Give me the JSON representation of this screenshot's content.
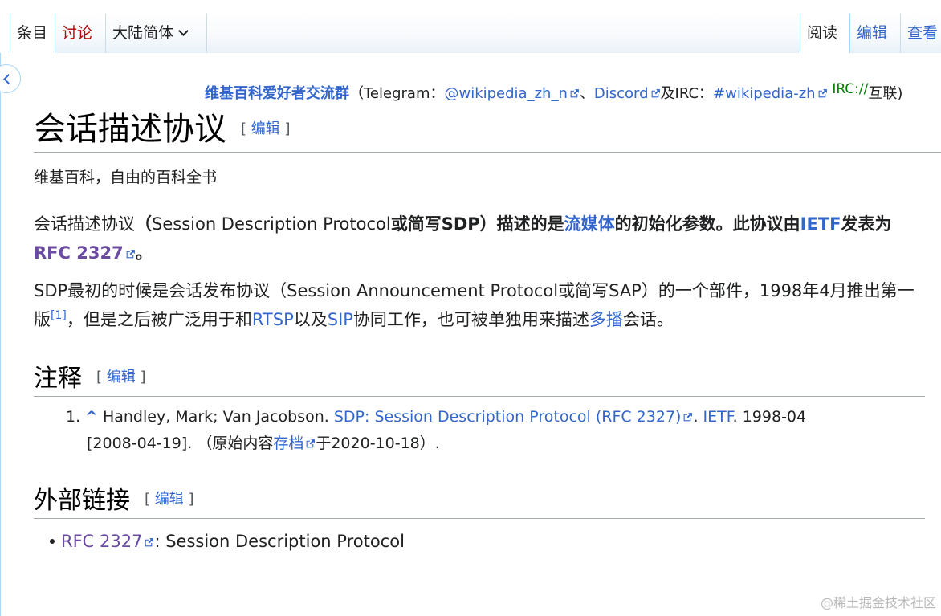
{
  "tabs": {
    "articles": "条目",
    "talk": "讨论",
    "variant": "大陆简体",
    "read": "阅读",
    "edit": "编辑",
    "history": "查看"
  },
  "notice": {
    "group": "维基百科爱好者交流群",
    "open": "（Telegram：",
    "telegram": "@wikipedia_zh_n",
    "sep1": "、",
    "discord": "Discord",
    "and_irc": "及IRC：",
    "irc_channel": "#wikipedia-zh",
    "irc_scheme": "IRC://",
    "tail": "互联)"
  },
  "page": {
    "title": "会话描述协议",
    "edit_open": "[",
    "edit_label": "编辑",
    "edit_close": "]",
    "tagline": "维基百科，自由的百科全书"
  },
  "para1": {
    "t1": "会话描述协议",
    "t2": "（",
    "t3": "Session Description Protocol",
    "t4": "或简写SDP）描述的是",
    "link_streaming": "流媒体",
    "t5": "的初始化参数。此协议由",
    "link_ietf": "IETF",
    "t6": "发表为 ",
    "link_rfc": "RFC 2327",
    "t7": "。"
  },
  "para2": {
    "t1": "SDP最初的时候是会话发布协议（Session Announcement Protocol或简写SAP）的一个部件，1998年4月推出第一版",
    "ref": "[1]",
    "t2": "，但是之后被广泛用于和",
    "link_rtsp": "RTSP",
    "t3": "以及",
    "link_sip": "SIP",
    "t4": "协同工作，也可被单独用来描述",
    "link_multicast": "多播",
    "t5": "会话。"
  },
  "sections": {
    "notes": "注释",
    "external": "外部链接"
  },
  "reference": {
    "num": "1.",
    "caret": "^",
    "authors": " Handley, Mark; Van Jacobson. ",
    "link_title": "SDP: Session Description Protocol (RFC 2327)",
    "dot1": ". ",
    "link_ietf": "IETF",
    "date": ". 1998-04",
    "accessed": "[2008-04-19]. （原始内容",
    "link_archive": "存档",
    "archived": "于2020-10-18）."
  },
  "external": {
    "link_rfc": "RFC 2327",
    "desc": ": Session Description Protocol"
  },
  "watermark": "@稀土掘金技术社区",
  "colors": {
    "link": "#3366cc",
    "visited": "#6b4ba1",
    "redlink": "#ba0000",
    "tab_border": "#a7d7f9",
    "irc_green": "#008000"
  }
}
